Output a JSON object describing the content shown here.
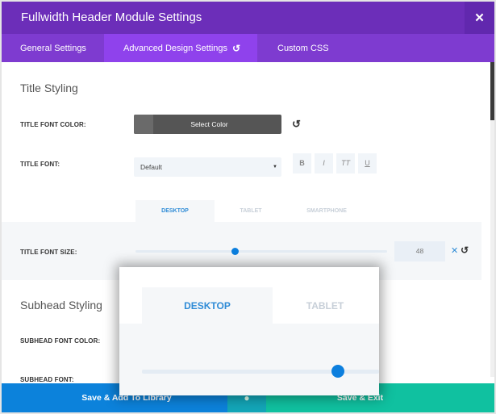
{
  "header": {
    "title": "Fullwidth Header Module Settings",
    "close_icon": "close-icon"
  },
  "tabs": [
    {
      "label": "General Settings",
      "active": false
    },
    {
      "label": "Advanced Design Settings",
      "active": true,
      "icon": "reset-icon",
      "icon_glyph": "↺"
    },
    {
      "label": "Custom CSS",
      "active": false
    }
  ],
  "title_styling": {
    "heading": "Title Styling",
    "font_color_label": "TITLE FONT COLOR:",
    "select_color_label": "Select Color",
    "font_label": "TITLE FONT:",
    "font_value": "Default",
    "caret": "▼",
    "format_buttons": [
      "B",
      "I",
      "TT",
      "U"
    ],
    "device_tabs": [
      "DESKTOP",
      "TABLET",
      "SMARTPHONE"
    ],
    "active_device": "DESKTOP",
    "font_size_label": "TITLE FONT SIZE:",
    "font_size_value": "48",
    "font_size_slider_fraction": 0.39,
    "clear_glyph": "✕",
    "reset_glyph": "↺"
  },
  "subhead_styling": {
    "heading": "Subhead Styling",
    "font_color_label": "SUBHEAD FONT COLOR:",
    "font_label": "SUBHEAD FONT:"
  },
  "footer": {
    "save_library_label": "Save & Add To Library",
    "middle_icon": "●",
    "save_exit_label": "Save & Exit"
  },
  "zoom_overlay": {
    "tabs": [
      "DESKTOP",
      "TABLET"
    ],
    "active_tab": "DESKTOP",
    "slider_fraction": 0.39
  },
  "colors": {
    "header": "#6c2eb9",
    "tabs_bar": "#7e3bd0",
    "active_tab": "#8f42ec",
    "accent_blue": "#0c7fde",
    "save_library": "#0c82db",
    "save_exit": "#10c1a0"
  }
}
